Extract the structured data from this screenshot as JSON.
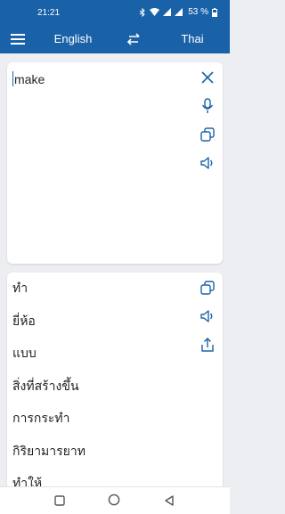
{
  "status_bar": {
    "time": "21:21",
    "battery": "53 %",
    "icons": [
      "bluetooth-icon",
      "wifi-icon",
      "signal-icon",
      "signal-icon",
      "battery-icon"
    ]
  },
  "toolbar": {
    "source_language": "English",
    "target_language": "Thai",
    "icons": [
      "menu-icon",
      "swap-icon"
    ]
  },
  "input": {
    "text": "make",
    "icons": [
      "close-icon",
      "microphone-icon",
      "copy-icon",
      "speaker-icon"
    ]
  },
  "output": {
    "results": [
      "ทำ",
      "ยี่ห้อ",
      "แบบ",
      "สิ่งที่สร้างขึ้น",
      "การกระทำ",
      "กิริยามารยาท",
      "ทำให้"
    ],
    "icons": [
      "copy-icon",
      "speaker-icon",
      "share-icon"
    ]
  },
  "nav_bar": {
    "icons": [
      "recents-square-icon",
      "home-circle-icon",
      "back-triangle-icon"
    ]
  },
  "colors": {
    "primary": "#1a62a8",
    "background": "#eceef2",
    "card": "#ffffff"
  }
}
